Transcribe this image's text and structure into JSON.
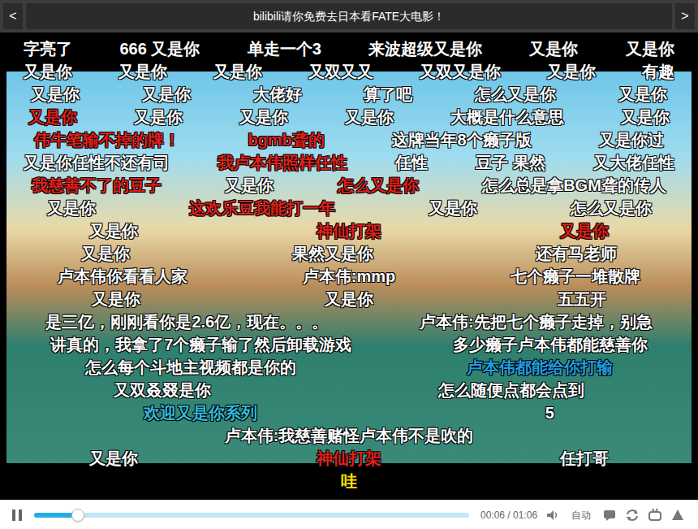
{
  "header": {
    "back": "<",
    "title": "bilibili请你免费去日本看FATE大电影！",
    "forward": ">"
  },
  "danmaku_lanes": [
    [
      {
        "text": "字亮了",
        "color": "#ffffff"
      },
      {
        "text": "666 又是你",
        "color": "#ffffff"
      },
      {
        "text": "单走一个3",
        "color": "#ffffff"
      },
      {
        "text": "来波超级又是你",
        "color": "#ffffff"
      },
      {
        "text": "又是你",
        "color": "#ffffff"
      },
      {
        "text": "又是你",
        "color": "#ffffff"
      }
    ],
    [
      {
        "text": "又是你",
        "color": "#ffffff"
      },
      {
        "text": "又是你",
        "color": "#ffffff"
      },
      {
        "text": "又是你",
        "color": "#ffffff"
      },
      {
        "text": "又双又又",
        "color": "#ffffff"
      },
      {
        "text": "又双又是你",
        "color": "#ffffff"
      },
      {
        "text": "又是你",
        "color": "#ffffff"
      },
      {
        "text": "有趣",
        "color": "#ffffff"
      }
    ],
    [
      {
        "text": "又是你",
        "color": "#ffffff"
      },
      {
        "text": "又是你",
        "color": "#ffffff"
      },
      {
        "text": "大佬好",
        "color": "#ffffff"
      },
      {
        "text": "算了吧",
        "color": "#ffffff"
      },
      {
        "text": "怎么又是你",
        "color": "#ffffff"
      },
      {
        "text": "又是你",
        "color": "#ffffff"
      }
    ],
    [
      {
        "text": "又是你",
        "color": "#e0201c"
      },
      {
        "text": "又是你",
        "color": "#ffffff"
      },
      {
        "text": "又是你",
        "color": "#ffffff"
      },
      {
        "text": "又是你",
        "color": "#ffffff"
      },
      {
        "text": "大概是什么意思",
        "color": "#ffffff"
      },
      {
        "text": "又是你",
        "color": "#ffffff"
      }
    ],
    [
      {
        "text": "伟牛笔输不掉的牌！",
        "color": "#e0201c"
      },
      {
        "text": "bgmb聋的",
        "color": "#e0201c"
      },
      {
        "text": "这牌当年8个癞子版",
        "color": "#ffffff"
      },
      {
        "text": "又是你过",
        "color": "#ffffff"
      }
    ],
    [
      {
        "text": "又是你任性不还有司",
        "color": "#ffffff"
      },
      {
        "text": "我卢本伟照样任性",
        "color": "#e0201c"
      },
      {
        "text": "任性",
        "color": "#ffffff"
      },
      {
        "text": "豆子 果然",
        "color": "#ffffff"
      },
      {
        "text": "又大佬任性",
        "color": "#ffffff"
      }
    ],
    [
      {
        "text": "我慈善不了的豆子",
        "color": "#e0201c"
      },
      {
        "text": "又是你",
        "color": "#ffffff"
      },
      {
        "text": "怎么又是你",
        "color": "#e0201c"
      },
      {
        "text": "怎么总是拿BGM聋的传人",
        "color": "#ffffff"
      }
    ],
    [
      {
        "text": "又是你",
        "color": "#ffffff"
      },
      {
        "text": "这欢乐豆我能打一年",
        "color": "#e0201c"
      },
      {
        "text": "又是你",
        "color": "#ffffff"
      },
      {
        "text": "怎么又是你",
        "color": "#ffffff"
      }
    ],
    [
      {
        "text": "又是你",
        "color": "#ffffff"
      },
      {
        "text": "神仙打架",
        "color": "#e0201c"
      },
      {
        "text": "又是你",
        "color": "#e0201c"
      }
    ],
    [
      {
        "text": "又是你",
        "color": "#ffffff"
      },
      {
        "text": "果然又是你",
        "color": "#ffffff"
      },
      {
        "text": "还有马老师",
        "color": "#ffffff"
      }
    ],
    [
      {
        "text": "卢本伟你看看人家",
        "color": "#ffffff"
      },
      {
        "text": "卢本伟:mmp",
        "color": "#ffffff"
      },
      {
        "text": "七个癞子一堆散牌",
        "color": "#ffffff"
      }
    ],
    [
      {
        "text": "又是你",
        "color": "#ffffff"
      },
      {
        "text": "又是你",
        "color": "#ffffff"
      },
      {
        "text": "五五开",
        "color": "#ffffff"
      }
    ],
    [
      {
        "text": "是三亿，刚刚看你是2.6亿，现在。。。",
        "color": "#ffffff"
      },
      {
        "text": "卢本伟:先把七个癞子走掉，别急",
        "color": "#ffffff"
      }
    ],
    [
      {
        "text": "讲真的，我拿了7个癞子输了然后卸载游戏",
        "color": "#ffffff"
      },
      {
        "text": "多少癞子卢本伟都能慈善你",
        "color": "#ffffff"
      }
    ],
    [
      {
        "text": "怎么每个斗地主视频都是你的",
        "color": "#ffffff"
      },
      {
        "text": "卢本伟都能给你打输",
        "color": "#1e9fe0"
      }
    ],
    [
      {
        "text": "又双叒叕是你",
        "color": "#ffffff"
      },
      {
        "text": "怎么随便点都会点到",
        "color": "#ffffff"
      }
    ],
    [
      {
        "text": "欢迎又是你系列",
        "color": "#33bbdd"
      },
      {
        "text": "5",
        "color": "#ffffff"
      }
    ],
    [
      {
        "text": "卢本伟:我慈善赌怪卢本伟不是吹的",
        "color": "#ffffff"
      }
    ],
    [
      {
        "text": "又是你",
        "color": "#ffffff"
      },
      {
        "text": "神仙打架",
        "color": "#e0201c"
      },
      {
        "text": "任打哥",
        "color": "#ffffff"
      }
    ],
    [
      {
        "text": "哇",
        "color": "#ffe000"
      }
    ]
  ],
  "player": {
    "playing": true,
    "progress": {
      "level": 0.1
    },
    "time": "00:06 / 01:06",
    "quality": "自动"
  }
}
